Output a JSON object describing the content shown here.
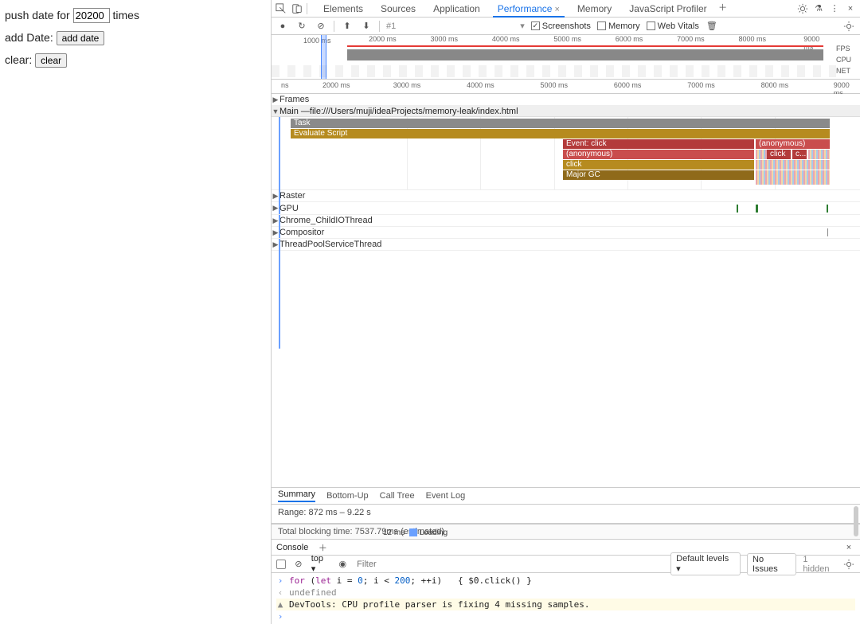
{
  "left": {
    "push_prefix": "push date for",
    "push_value": "20200",
    "push_suffix": "times",
    "add_label": "add Date:",
    "add_btn": "add date",
    "clear_label": "clear:",
    "clear_btn": "clear"
  },
  "devtools_tabs": {
    "elements": "Elements",
    "sources": "Sources",
    "application": "Application",
    "performance": "Performance",
    "memory": "Memory",
    "jsprofiler": "JavaScript Profiler"
  },
  "toolbar": {
    "rec_num": "#1",
    "screenshots": "Screenshots",
    "memory": "Memory",
    "webvitals": "Web Vitals"
  },
  "overview": {
    "start_label": "1000 ms",
    "ticks": [
      "2000 ms",
      "3000 ms",
      "4000 ms",
      "5000 ms",
      "6000 ms",
      "7000 ms",
      "8000 ms",
      "9000 ms"
    ],
    "side": {
      "fps": "FPS",
      "cpu": "CPU",
      "net": "NET"
    }
  },
  "ruler": {
    "start": "ns",
    "ticks": [
      "2000 ms",
      "3000 ms",
      "4000 ms",
      "5000 ms",
      "6000 ms",
      "7000 ms",
      "8000 ms",
      "9000 ms"
    ]
  },
  "tracks": {
    "frames": "Frames",
    "main_prefix": "Main — ",
    "main_path": "file:///Users/muji/ideaProjects/memory-leak/index.html",
    "raster": "Raster",
    "gpu": "GPU",
    "childio": "Chrome_ChildIOThread",
    "compositor": "Compositor",
    "threadpool": "ThreadPoolServiceThread"
  },
  "flame": {
    "task": "Task",
    "evaluate": "Evaluate Script",
    "event_click": "Event: click",
    "anonymous": "(anonymous)",
    "click": "click",
    "c": "c...",
    "majorgc": "Major GC"
  },
  "bottom": {
    "summary": "Summary",
    "bottomup": "Bottom-Up",
    "calltree": "Call Tree",
    "eventlog": "Event Log",
    "range": "Range: 872 ms – 9.22 s",
    "loading_ms": "12 ms",
    "loading_lbl": "Loading",
    "tbt": "Total blocking time: 7537.79ms (estimated)"
  },
  "console": {
    "tab": "Console",
    "top": "top ▾",
    "filter_placeholder": "Filter",
    "default_levels": "Default levels ▾",
    "no_issues": "No Issues",
    "hidden": "1 hidden",
    "code_line": "for (let i = 0; i < 200; ++i)   { $0.click() }",
    "undefined": "undefined",
    "warn": "DevTools: CPU profile parser is fixing 4 missing samples."
  }
}
